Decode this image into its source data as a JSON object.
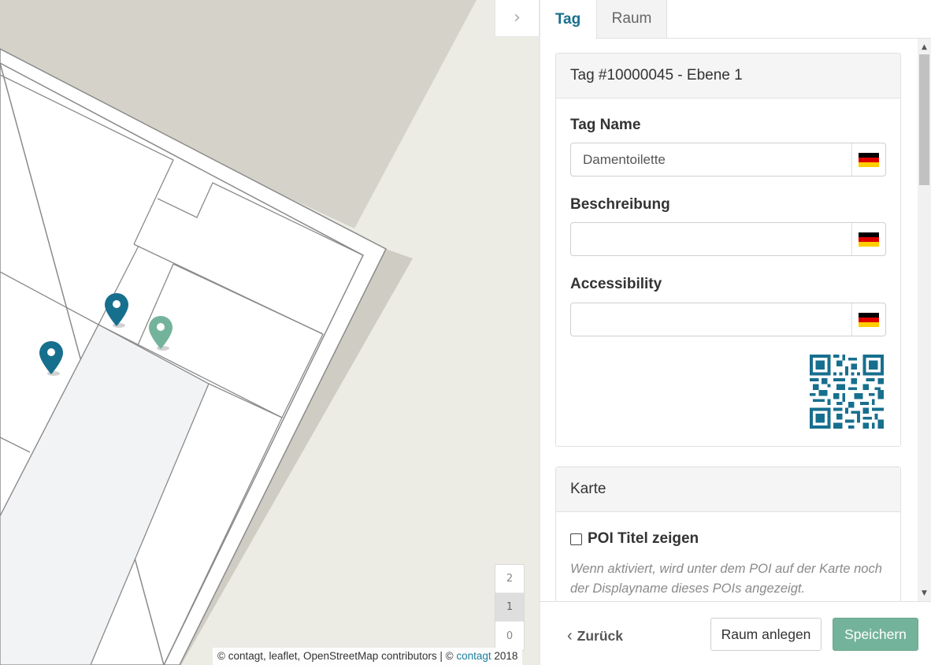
{
  "map": {
    "collapse_icon": "chevron-right-icon",
    "floors": [
      {
        "label": "2",
        "active": false
      },
      {
        "label": "1",
        "active": true
      },
      {
        "label": "0",
        "active": false
      }
    ],
    "attribution": {
      "prefix": "© contagt, leaflet, OpenStreetMap contributors | ©",
      "link": "contagt",
      "suffix": "2018"
    },
    "pin_colors": {
      "primary": "#176f8e",
      "selected": "#74b39b"
    }
  },
  "panel": {
    "tabs": [
      {
        "label": "Tag",
        "active": true
      },
      {
        "label": "Raum",
        "active": false
      }
    ],
    "tag_card": {
      "title": "Tag #10000045 - Ebene 1",
      "fields": [
        {
          "label": "Tag Name",
          "value": "Damentoilette",
          "flag": "de-flag-icon"
        },
        {
          "label": "Beschreibung",
          "value": "",
          "flag": "de-flag-icon"
        },
        {
          "label": "Accessibility",
          "value": "",
          "flag": "de-flag-icon"
        }
      ],
      "qr_icon": "qr-code-icon"
    },
    "map_card": {
      "title": "Karte",
      "checkbox_label": "POI Titel zeigen",
      "checkbox_checked": false,
      "help_text": "Wenn aktiviert, wird unter dem POI auf der Karte noch der Displayname dieses POIs angezeigt."
    },
    "footer": {
      "back_label": "Zurück",
      "create_room_label": "Raum anlegen",
      "save_label": "Speichern"
    },
    "colors": {
      "accent": "#176f8e",
      "save": "#74b39b"
    }
  }
}
